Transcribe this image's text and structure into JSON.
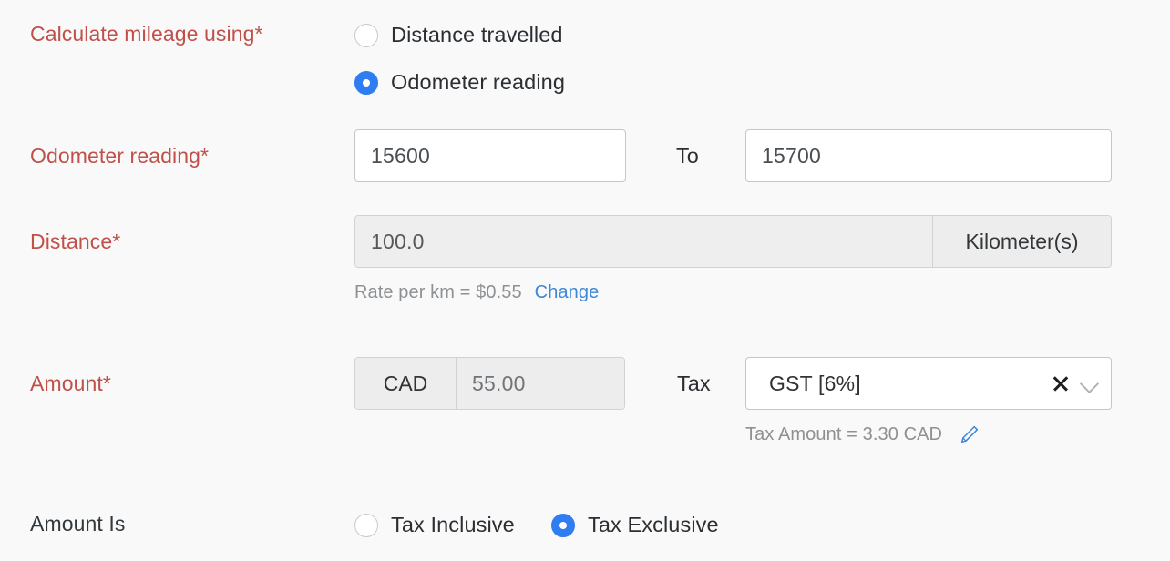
{
  "form": {
    "fields": [
      {
        "label": "Calculate mileage using*",
        "required": true,
        "type": "radio-group",
        "options": [
          {
            "label": "Distance travelled",
            "selected": false
          },
          {
            "label": "Odometer reading",
            "selected": true
          }
        ]
      },
      {
        "label": "Odometer reading*",
        "required": true,
        "type": "range",
        "from_value": "15600",
        "separator": "To",
        "to_value": "15700"
      },
      {
        "label": "Distance*",
        "required": true,
        "type": "readonly-with-unit",
        "value": "100.0",
        "unit": "Kilometer(s)",
        "hint_text": "Rate per km = $0.55",
        "hint_link": "Change"
      },
      {
        "label": "Amount*",
        "required": true,
        "type": "currency-with-tax",
        "currency": "CAD",
        "value": "55.00",
        "tax_label": "Tax",
        "tax_value": "GST [6%]",
        "tax_amount_text": "Tax Amount = 3.30 CAD"
      },
      {
        "label": "Amount Is",
        "required": false,
        "type": "radio-group",
        "options": [
          {
            "label": "Tax Inclusive",
            "selected": false
          },
          {
            "label": "Tax Exclusive",
            "selected": true
          }
        ]
      }
    ]
  },
  "icons": {
    "clear": "close-x-icon",
    "dropdown": "chevron-down-icon",
    "edit": "pencil-edit-icon"
  },
  "colors": {
    "required_label": "#c0504a",
    "accent_blue": "#2f7df0",
    "link_blue": "#3c87d6",
    "background": "#f9f9f9"
  }
}
